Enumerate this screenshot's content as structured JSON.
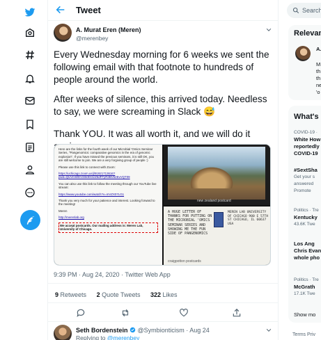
{
  "header": {
    "title": "Tweet"
  },
  "nav": {
    "items": [
      "twitter-logo-icon",
      "explore-icon",
      "hashtag-icon",
      "notifications-icon",
      "messages-icon",
      "bookmarks-icon",
      "lists-icon",
      "profile-icon",
      "more-icon",
      "compose-icon"
    ]
  },
  "tweet": {
    "author_name": "A. Murat Eren (Meren)",
    "author_handle": "@merenbey",
    "paragraph1": "Every Wednesday morning for 6 weeks we sent the following email with that footnote to hundreds of people around the world.",
    "paragraph2": "After weeks of silence, this arrived today. Needless to say, we were screaming in Slack",
    "emoji": "😅",
    "paragraph3": "Thank YOU. It was all worth it, and we will do it again.",
    "timestamp": "9:39 PM · Aug 24, 2020 · Twitter Web App",
    "retweets_count": "9",
    "retweets_label": "Retweets",
    "quotes_count": "2",
    "quotes_label": "Quote Tweets",
    "likes_count": "322",
    "likes_label": "Likes"
  },
  "email_image": {
    "line1": "Here are the links for the fourth week of our Microbial 'Omics Seminar Series, \"Pangenomics: comparative genomics in the era of genomic explosion\". If you have missed the previous seminars, it is still OK, you are still welcome to join. We are a very forgiving group of people :)",
    "line2": "Please use this link to connect with Zoom:",
    "link1": "https://uchicago.zoom.us/j/91921713616?pwd=QUVmWDV3Sk9XSzZ6dFFyR3BVb2EvVQT09",
    "line3": "You can also use this link to follow the meeting through our YouTube live stream:",
    "link2": "https://www.youtube.com/watch?v=mVZX07LG1",
    "line4": "Thank you very much for your patience and interest. Looking forward to the meeting!",
    "sign": "Meren",
    "link3": "http://merenlab.org",
    "footnote": "We accept postcards. Our mailing address is: Meren Lab, University of Chicago."
  },
  "postcard_front": {
    "label": "new zealand postcard"
  },
  "postcard_back": {
    "handwriting": "A huge letter of thanks for putting on the microbial 'omics seminar series and showing me the fun side of pangenomics",
    "address": "Meren Lab University of Chicago 900 E 57th St Chicago, IL 60637 USA",
    "footer": "craigpotton postcards"
  },
  "reply": {
    "name": "Seth Bordenstein",
    "handle_time": "@Symbionticism · Aug 24",
    "replying_prefix": "Replying to",
    "replying_handle": "@merenbey"
  },
  "sidebar": {
    "search_placeholder": "Search",
    "relevant_title": "Relevant",
    "relevant_name": "A.",
    "relevant_lines": [
      "M",
      "th",
      "th",
      "ne",
      "'o"
    ],
    "happening_title": "What's",
    "trends": [
      {
        "context": "COVID-19 ·",
        "title": "White How",
        "lines": [
          "reportedly",
          "COVID-19"
        ]
      },
      {
        "context": "",
        "title": "#SextSha",
        "lines": [
          "Get your s",
          "answered"
        ],
        "promo": "Promote"
      },
      {
        "context": "Politics · Tre",
        "title": "Kentucky",
        "lines": [
          "43.6K Twe"
        ]
      },
      {
        "context": "Los Ang",
        "title": "Chris Evan",
        "lines": [
          "whole pho"
        ]
      },
      {
        "context": "Politics · Tre",
        "title": "McGrath",
        "lines": [
          "17.1K Twe"
        ]
      }
    ],
    "show_more": "Show mo",
    "footer": "Terms   Priv"
  },
  "colors": {
    "accent": "#1d9bf0",
    "text": "#0f1419",
    "muted": "#536471"
  }
}
